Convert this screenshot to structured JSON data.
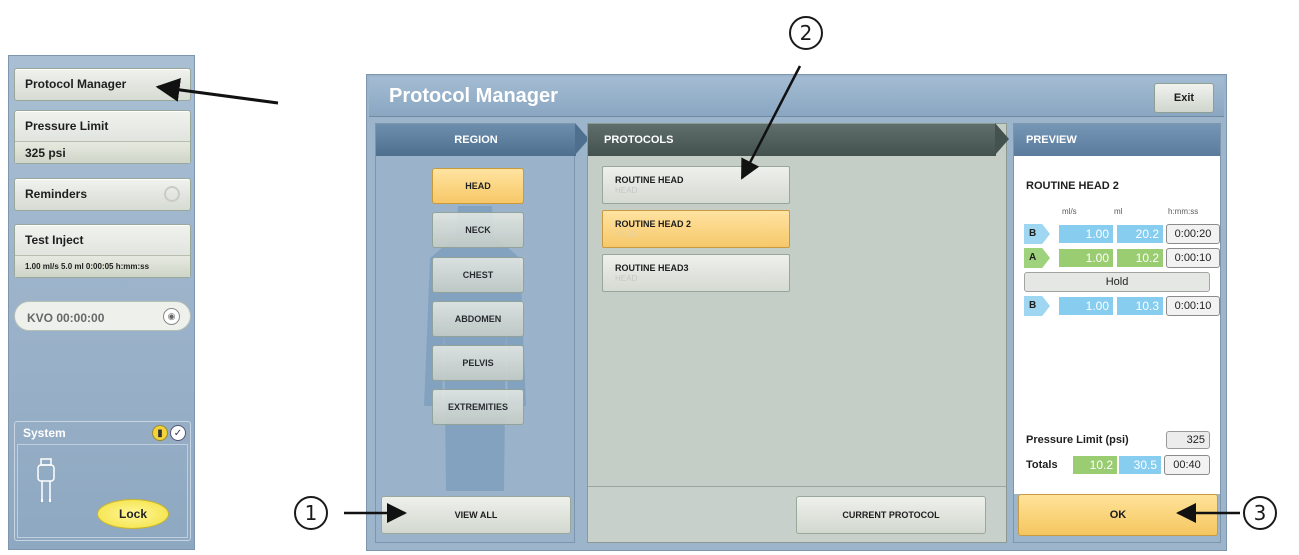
{
  "left_panel": {
    "protocol_manager_label": "Protocol Manager",
    "pressure_limit_label": "Pressure Limit",
    "pressure_limit_value": "325 psi",
    "reminders_label": "Reminders",
    "test_inject_label": "Test Inject",
    "test_inject_value": "1.00 ml/s 5.0 ml 0:00:05 h:mm:ss",
    "kvo_label": "KVO 00:00:00",
    "system_label": "System",
    "lock_label": "Lock"
  },
  "dialog": {
    "title": "Protocol Manager",
    "exit_label": "Exit",
    "region": {
      "header": "REGION",
      "buttons": [
        "HEAD",
        "NECK",
        "CHEST",
        "ABDOMEN",
        "PELVIS",
        "EXTREMITIES"
      ],
      "selected": "HEAD",
      "view_all_label": "VIEW ALL"
    },
    "protocols": {
      "header": "PROTOCOLS",
      "items": [
        {
          "name": "ROUTINE HEAD",
          "region": "HEAD",
          "selected": false
        },
        {
          "name": "ROUTINE HEAD 2",
          "region": "HEAD",
          "selected": true
        },
        {
          "name": "ROUTINE HEAD3",
          "region": "HEAD",
          "selected": false
        }
      ],
      "current_protocol_label": "CURRENT PROTOCOL"
    },
    "preview": {
      "header": "PREVIEW",
      "protocol_name": "ROUTINE HEAD 2",
      "unit_flow": "ml/s",
      "unit_volume": "ml",
      "unit_duration": "h:mm:ss",
      "phases": [
        {
          "syringe": "B",
          "flow": "1.00",
          "volume": "20.2",
          "duration": "0:00:20"
        },
        {
          "syringe": "A",
          "flow": "1.00",
          "volume": "10.2",
          "duration": "0:00:10"
        },
        {
          "syringe": "B",
          "flow": "1.00",
          "volume": "10.3",
          "duration": "0:00:10"
        }
      ],
      "hold_label": "Hold",
      "pressure_limit_label": "Pressure Limit (psi)",
      "pressure_limit_value": "325",
      "totals_label": "Totals",
      "total_a": "10.2",
      "total_b": "30.5",
      "total_duration": "00:40",
      "ok_label": "OK"
    }
  },
  "callouts": [
    "1",
    "2",
    "3"
  ],
  "colors": {
    "panel_blue": "#9db5cb",
    "selected_amber": "#f6c86a",
    "syringe_b": "#86cdf0",
    "syringe_a": "#9acd72"
  }
}
